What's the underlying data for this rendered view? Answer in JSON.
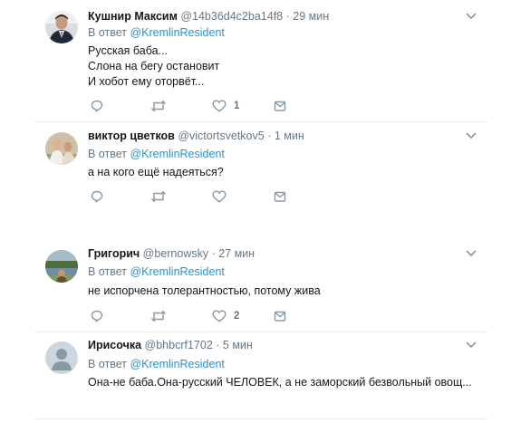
{
  "reply_prefix": "В ответ",
  "tweets": [
    {
      "name": "Кушнир Максим",
      "handle": "@14b36d4c2ba14f8",
      "time": "29 мин",
      "reply_to": "@KremlinResident",
      "lines": [
        "Русская баба...",
        "Слона на бегу остановит",
        "И хобот ему оторвёт..."
      ],
      "like_count": "1"
    },
    {
      "name": "виктор цветков",
      "handle": "@victortsvetkov5",
      "time": "1 мин",
      "reply_to": "@KremlinResident",
      "lines": [
        "а на кого ещё надеяться?"
      ],
      "like_count": ""
    },
    {
      "name": "Григорич",
      "handle": "@bernowsky",
      "time": "27 мин",
      "reply_to": "@KremlinResident",
      "lines": [
        "не испорчена толерантностью, потому жива"
      ],
      "like_count": "2"
    },
    {
      "name": "Ирисочка",
      "handle": "@bhbcrf1702",
      "time": "5 мин",
      "reply_to": "@KremlinResident",
      "lines": [
        "Она-не баба.Она-русский ЧЕЛОВЕК, а не заморский безвольный овощ..."
      ],
      "like_count": ""
    }
  ],
  "icons": {
    "reply": "reply-icon",
    "retweet": "retweet-icon",
    "like": "heart-icon",
    "dm": "envelope-icon",
    "more": "chevron-down-icon"
  },
  "colors": {
    "name": "#14171a",
    "meta": "#657786",
    "mention": "#1b95e0",
    "icon": "#8899a6",
    "divider": "#e6ecf0"
  }
}
